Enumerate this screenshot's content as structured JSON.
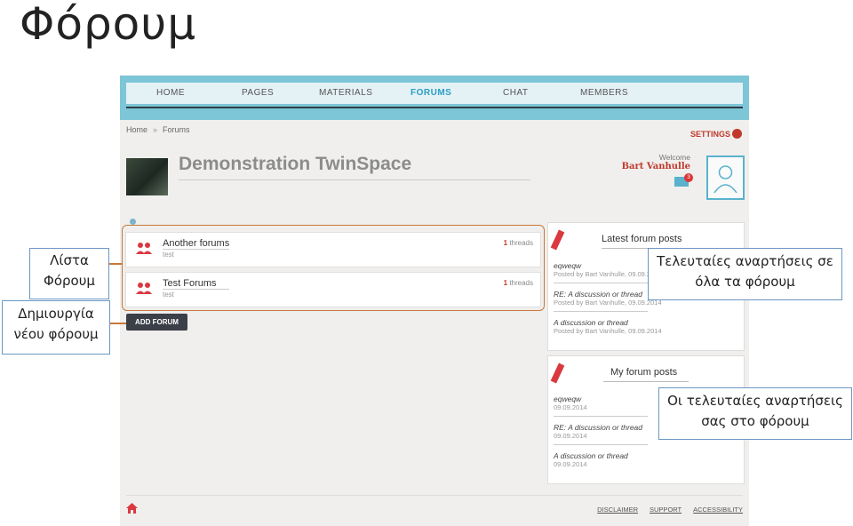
{
  "slide": {
    "title": "Φόρουμ"
  },
  "nav": {
    "items": [
      "HOME",
      "PAGES",
      "MATERIALS",
      "FORUMS",
      "CHAT",
      "MEMBERS"
    ],
    "active": "FORUMS"
  },
  "breadcrumb": {
    "home": "Home",
    "separator": "»",
    "current": "Forums"
  },
  "header": {
    "settings_label": "SETTINGS",
    "space_title": "Demonstration TwinSpace",
    "welcome": "Welcome",
    "user": "Bart Vanhulle",
    "mail_badge": "3"
  },
  "forums": [
    {
      "name": "Another forums",
      "description": "test",
      "thread_count": "1",
      "thread_label": "threads"
    },
    {
      "name": "Test Forums",
      "description": "test",
      "thread_count": "1",
      "thread_label": "threads"
    }
  ],
  "add_forum_label": "ADD FORUM",
  "latest": {
    "title": "Latest forum posts",
    "posts": [
      {
        "title": "eqweqw",
        "meta": "Posted by Bart Vanhulle, 09.09.2014"
      },
      {
        "title": "RE: A discussion or thread",
        "meta": "Posted by Bart Vanhulle, 09.09.2014"
      },
      {
        "title": "A discussion or thread",
        "meta": "Posted by Bart Vanhulle, 09.09.2014"
      }
    ]
  },
  "mine": {
    "title": "My forum posts",
    "posts": [
      {
        "title": "eqweqw",
        "meta": "09.09.2014"
      },
      {
        "title": "RE: A discussion or thread",
        "meta": "09.09.2014"
      },
      {
        "title": "A discussion or thread",
        "meta": "09.09.2014"
      }
    ]
  },
  "footer": {
    "links": [
      "DISCLAIMER",
      "SUPPORT",
      "ACCESSIBILITY"
    ]
  },
  "callouts": {
    "forum_list": "Λίστα Φόρουμ",
    "create_forum": "Δημιουργία νέου φόρουμ",
    "latest_all": "Τελευταίες αναρτήσεις σε όλα τα φόρουμ",
    "your_latest": "Οι τελευταίες αναρτήσεις σας στο φόρουμ"
  },
  "colors": {
    "accent": "#2a9fc4",
    "brand_red": "#c0392b",
    "callout_border": "#6a97c4",
    "connector": "#c8783a",
    "band": "#7dc6d7"
  }
}
